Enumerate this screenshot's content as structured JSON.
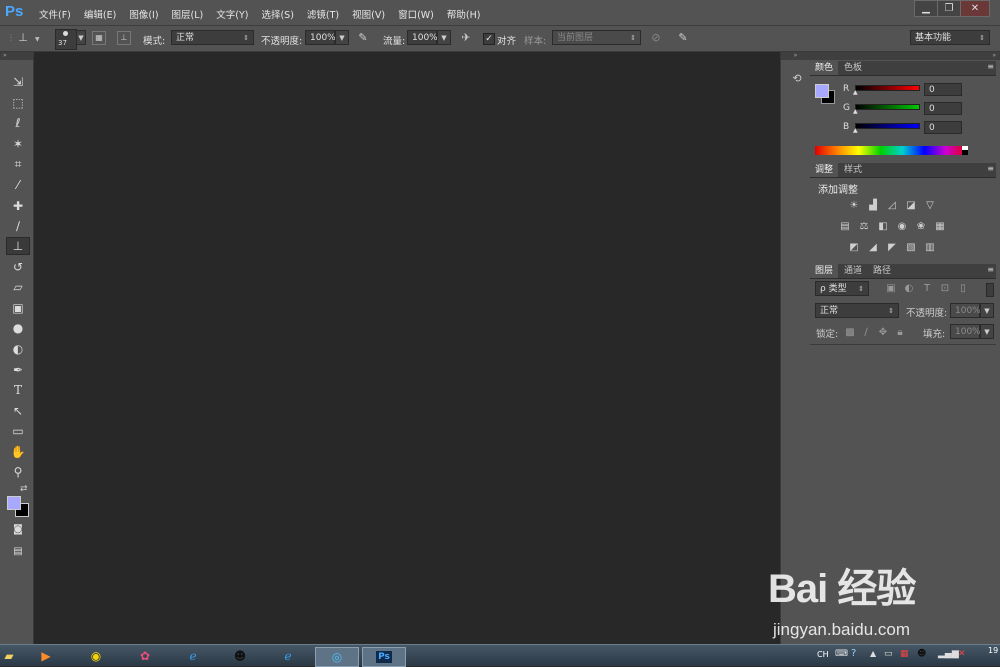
{
  "app": {
    "logo": "Ps"
  },
  "menu": [
    "文件(F)",
    "编辑(E)",
    "图像(I)",
    "图层(L)",
    "文字(Y)",
    "选择(S)",
    "滤镜(T)",
    "视图(V)",
    "窗口(W)",
    "帮助(H)"
  ],
  "window_buttons": [
    "▁",
    "❐",
    "✕"
  ],
  "options": {
    "brush_size": "37",
    "mode_label": "模式:",
    "mode_value": "正常",
    "opacity_label": "不透明度:",
    "opacity_value": "100%",
    "flow_label": "流量:",
    "flow_value": "100%",
    "align_label": "对齐",
    "sample_label": "样本:",
    "sample_value": "当前图层",
    "workspace": "基本功能"
  },
  "tools": [
    "move-tool-icon",
    "marquee-tool-icon",
    "lasso-tool-icon",
    "magic-wand-icon",
    "crop-tool-icon",
    "eyedropper-icon",
    "healing-brush-icon",
    "brush-tool-icon",
    "clone-stamp-icon",
    "history-brush-icon",
    "eraser-icon",
    "gradient-tool-icon",
    "blur-tool-icon",
    "dodge-tool-icon",
    "pen-tool-icon",
    "type-tool-icon",
    "path-select-icon",
    "shape-tool-icon",
    "hand-tool-icon",
    "zoom-tool-icon"
  ],
  "colors": {
    "foreground": "#a8a8ff",
    "background": "#000000",
    "accent": "#4aa8ff"
  },
  "color_panel": {
    "tabs": [
      "颜色",
      "色板"
    ],
    "channels": [
      {
        "label": "R",
        "value": "0"
      },
      {
        "label": "G",
        "value": "0"
      },
      {
        "label": "B",
        "value": "0"
      }
    ]
  },
  "adjust_panel": {
    "tabs": [
      "调整",
      "样式"
    ],
    "title": "添加调整"
  },
  "layers_panel": {
    "tabs": [
      "图层",
      "通道",
      "路径"
    ],
    "filter_label": "ρ 类型",
    "blend_mode": "正常",
    "opacity_label": "不透明度:",
    "opacity_value": "100%",
    "lock_label": "锁定:",
    "fill_label": "填充:",
    "fill_value": "100%"
  },
  "taskbar": {
    "tray_lang": "CH",
    "clock": "19"
  },
  "watermark": {
    "logo": "Bai 经验",
    "url": "jingyan.baidu.com"
  }
}
